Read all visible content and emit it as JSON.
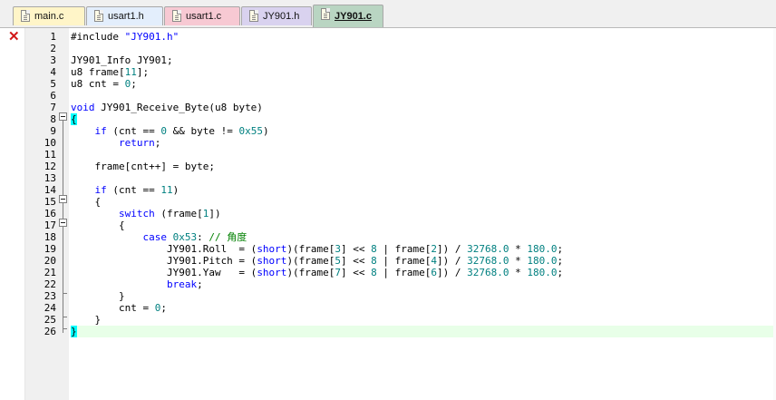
{
  "tabs": [
    {
      "label": "main.c",
      "color": "#fff5c8",
      "active": false
    },
    {
      "label": "usart1.h",
      "color": "#e3eefc",
      "active": false
    },
    {
      "label": "usart1.c",
      "color": "#f7c9d3",
      "active": false
    },
    {
      "label": "JY901.h",
      "color": "#d9d2ef",
      "active": false
    },
    {
      "label": "JY901.c",
      "color": "#b9d5c2",
      "active": true
    }
  ],
  "editor": {
    "error_marker": "✕",
    "lines": [
      {
        "n": "1",
        "tokens": [
          {
            "t": "#include "
          },
          {
            "t": "\"JY901.h\"",
            "c": "str"
          }
        ]
      },
      {
        "n": "2",
        "tokens": []
      },
      {
        "n": "3",
        "tokens": [
          {
            "t": "JY901_Info JY901;"
          }
        ]
      },
      {
        "n": "4",
        "tokens": [
          {
            "t": "u8 frame["
          },
          {
            "t": "11",
            "c": "num"
          },
          {
            "t": "];"
          }
        ]
      },
      {
        "n": "5",
        "tokens": [
          {
            "t": "u8 cnt = "
          },
          {
            "t": "0",
            "c": "num"
          },
          {
            "t": ";"
          }
        ]
      },
      {
        "n": "6",
        "tokens": []
      },
      {
        "n": "7",
        "tokens": [
          {
            "t": "void",
            "c": "kw"
          },
          {
            "t": " JY901_Receive_Byte(u8 byte)"
          }
        ]
      },
      {
        "n": "8",
        "tokens": [
          {
            "t": "{",
            "c": "brace-hl"
          }
        ]
      },
      {
        "n": "9",
        "tokens": [
          {
            "t": "    "
          },
          {
            "t": "if",
            "c": "kw"
          },
          {
            "t": " (cnt == "
          },
          {
            "t": "0",
            "c": "num"
          },
          {
            "t": " && byte != "
          },
          {
            "t": "0x55",
            "c": "num"
          },
          {
            "t": ")"
          }
        ]
      },
      {
        "n": "10",
        "tokens": [
          {
            "t": "        "
          },
          {
            "t": "return",
            "c": "kw"
          },
          {
            "t": ";"
          }
        ]
      },
      {
        "n": "11",
        "tokens": []
      },
      {
        "n": "12",
        "tokens": [
          {
            "t": "    frame[cnt++] = byte;"
          }
        ]
      },
      {
        "n": "13",
        "tokens": []
      },
      {
        "n": "14",
        "tokens": [
          {
            "t": "    "
          },
          {
            "t": "if",
            "c": "kw"
          },
          {
            "t": " (cnt == "
          },
          {
            "t": "11",
            "c": "num"
          },
          {
            "t": ")"
          }
        ]
      },
      {
        "n": "15",
        "tokens": [
          {
            "t": "    {"
          }
        ]
      },
      {
        "n": "16",
        "tokens": [
          {
            "t": "        "
          },
          {
            "t": "switch",
            "c": "kw"
          },
          {
            "t": " (frame["
          },
          {
            "t": "1",
            "c": "num"
          },
          {
            "t": "])"
          }
        ]
      },
      {
        "n": "17",
        "tokens": [
          {
            "t": "        {"
          }
        ]
      },
      {
        "n": "18",
        "tokens": [
          {
            "t": "            "
          },
          {
            "t": "case",
            "c": "kw"
          },
          {
            "t": " "
          },
          {
            "t": "0x53",
            "c": "num"
          },
          {
            "t": ": "
          },
          {
            "t": "// 角度",
            "c": "cmt"
          }
        ]
      },
      {
        "n": "19",
        "tokens": [
          {
            "t": "                JY901.Roll  = ("
          },
          {
            "t": "short",
            "c": "kw"
          },
          {
            "t": ")(frame["
          },
          {
            "t": "3",
            "c": "num"
          },
          {
            "t": "] << "
          },
          {
            "t": "8",
            "c": "num"
          },
          {
            "t": " | frame["
          },
          {
            "t": "2",
            "c": "num"
          },
          {
            "t": "]) / "
          },
          {
            "t": "32768.0",
            "c": "num"
          },
          {
            "t": " * "
          },
          {
            "t": "180.0",
            "c": "num"
          },
          {
            "t": ";"
          }
        ]
      },
      {
        "n": "20",
        "tokens": [
          {
            "t": "                JY901.Pitch = ("
          },
          {
            "t": "short",
            "c": "kw"
          },
          {
            "t": ")(frame["
          },
          {
            "t": "5",
            "c": "num"
          },
          {
            "t": "] << "
          },
          {
            "t": "8",
            "c": "num"
          },
          {
            "t": " | frame["
          },
          {
            "t": "4",
            "c": "num"
          },
          {
            "t": "]) / "
          },
          {
            "t": "32768.0",
            "c": "num"
          },
          {
            "t": " * "
          },
          {
            "t": "180.0",
            "c": "num"
          },
          {
            "t": ";"
          }
        ]
      },
      {
        "n": "21",
        "tokens": [
          {
            "t": "                JY901.Yaw   = ("
          },
          {
            "t": "short",
            "c": "kw"
          },
          {
            "t": ")(frame["
          },
          {
            "t": "7",
            "c": "num"
          },
          {
            "t": "] << "
          },
          {
            "t": "8",
            "c": "num"
          },
          {
            "t": " | frame["
          },
          {
            "t": "6",
            "c": "num"
          },
          {
            "t": "]) / "
          },
          {
            "t": "32768.0",
            "c": "num"
          },
          {
            "t": " * "
          },
          {
            "t": "180.0",
            "c": "num"
          },
          {
            "t": ";"
          }
        ]
      },
      {
        "n": "22",
        "tokens": [
          {
            "t": "                "
          },
          {
            "t": "break",
            "c": "kw"
          },
          {
            "t": ";"
          }
        ]
      },
      {
        "n": "23",
        "tokens": [
          {
            "t": "        }"
          }
        ]
      },
      {
        "n": "24",
        "tokens": [
          {
            "t": "        cnt = "
          },
          {
            "t": "0",
            "c": "num"
          },
          {
            "t": ";"
          }
        ]
      },
      {
        "n": "25",
        "tokens": [
          {
            "t": "    }"
          }
        ]
      },
      {
        "n": "26",
        "tokens": [
          {
            "t": "}",
            "c": "brace-hl"
          }
        ],
        "current": true
      }
    ]
  }
}
